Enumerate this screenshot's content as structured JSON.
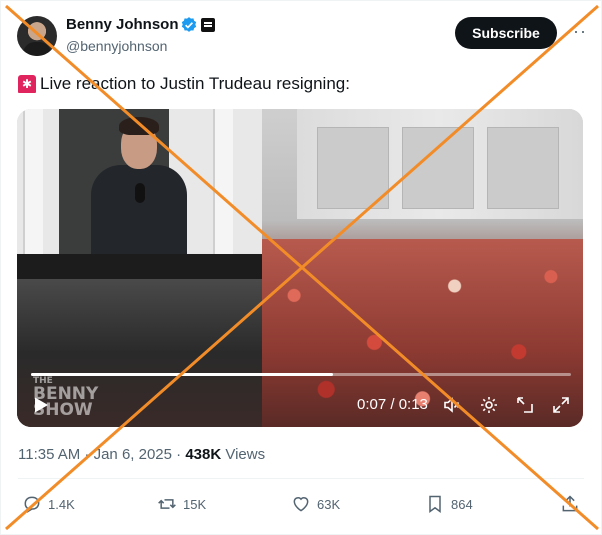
{
  "author": {
    "name": "Benny Johnson",
    "handle": "@bennyjohnson"
  },
  "subscribe_label": "Subscribe",
  "more_label": "···",
  "tweet": {
    "text": "Live reaction to Justin Trudeau resigning:"
  },
  "video": {
    "watermark_line1": "THE",
    "watermark_line2": "BENNY",
    "watermark_line3": "SHOW",
    "time": "0:07 / 0:13",
    "progress": 0.56
  },
  "meta": {
    "timestamp": "11:35 AM · Jan 6, 2025 · ",
    "views_count": "438K",
    "views_label": " Views"
  },
  "actions": {
    "replies": "1.4K",
    "reposts": "15K",
    "likes": "63K",
    "bookmarks": "864"
  },
  "colors": {
    "text": "#0f1419",
    "muted": "#536471",
    "verified": "#1d9bf0",
    "overlay_cross": "#f28c28"
  }
}
